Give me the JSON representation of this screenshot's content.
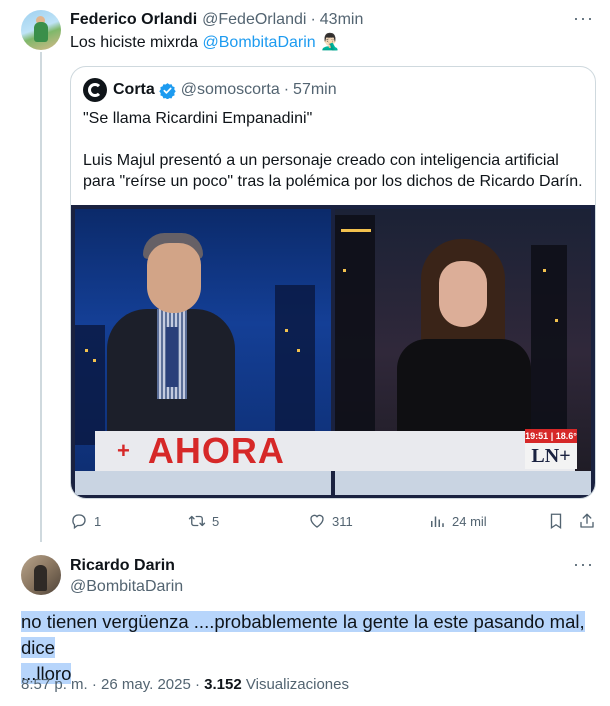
{
  "post1": {
    "display_name": "Federico Orlandi",
    "handle": "@FedeOrlandi",
    "separator": "·",
    "time": "43min",
    "text_prefix": "Los hiciste mixrda",
    "mention": "@BombitaDarin",
    "emoji": "🤦🏻‍♂️",
    "more_label": "···"
  },
  "quote": {
    "display_name": "Corta",
    "handle": "@somoscorta",
    "separator": "·",
    "time": "57min",
    "line1": "\"Se llama Ricardini Empanadini\"",
    "line2": "Luis Majul presentó a un personaje creado con inteligencia artificial para \"reírse un poco\" tras la polémica por los dichos de Ricardo Darín.",
    "media": {
      "banner_plus": "+",
      "banner_text": "AHORA",
      "clock": "19:51 | 18.6°",
      "channel_logo": "LN+"
    }
  },
  "actions": {
    "replies": "1",
    "reposts": "5",
    "likes": "311",
    "views": "24 mil"
  },
  "post2": {
    "display_name": "Ricardo Darin",
    "handle": "@BombitaDarin",
    "more_label": "···",
    "text_line1": "no tienen vergüenza ....probablemente la gente la este pasando mal, dice",
    "text_line2": "...lloro",
    "timestamp": "8:57 p. m. · 26 may. 2025 ·",
    "views_count": "3.152",
    "views_label": "Visualizaciones"
  },
  "colors": {
    "accent": "#1d9bf0",
    "muted": "#536471",
    "highlight": "#b7d5fb",
    "banner_red": "#d62828"
  }
}
